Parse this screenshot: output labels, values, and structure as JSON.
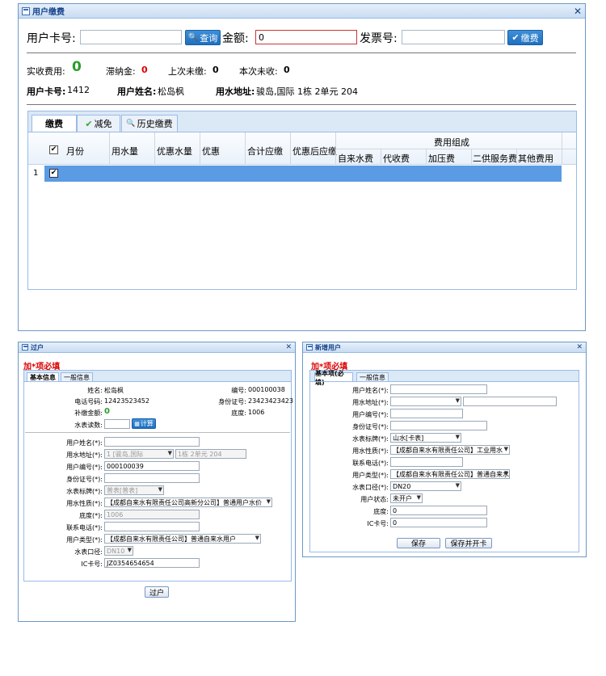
{
  "main": {
    "title": "用户缴费",
    "card_label": "用户卡号:",
    "card_value": "",
    "query_button": "查询",
    "amount_label": "金额:",
    "amount_value": "0",
    "invoice_label": "发票号:",
    "invoice_value": "",
    "pay_button": "缴费",
    "actual_label": "实收费用:",
    "actual_value": "0",
    "late_label": "滞纳金:",
    "late_value": "0",
    "last_unpaid_label": "上次未缴:",
    "last_unpaid_value": "0",
    "this_unpaid_label": "本次未收:",
    "this_unpaid_value": "0",
    "user_card_label": "用户卡号:",
    "user_card_value": "1412",
    "user_name_label": "用户姓名:",
    "user_name_value": "松岛枫",
    "address_label": "用水地址:",
    "address_value": "骏岛,国际 1栋 2单元 204",
    "tabs": [
      "缴费",
      "减免",
      "历史缴费"
    ],
    "grid": {
      "columns": [
        "月份",
        "用水量",
        "优惠水量",
        "优惠",
        "合计应缴",
        "优惠后应缴"
      ],
      "group_header": "费用组成",
      "sub_columns": [
        "自来水费",
        "代收费",
        "加压费",
        "二供服务费",
        "其他费用"
      ],
      "row_number": "1"
    }
  },
  "transfer": {
    "title": "过户",
    "required_note": "加*项必填",
    "tabs": [
      "基本信息",
      "一般信息"
    ],
    "info": {
      "name_label": "姓名:",
      "name_value": "松岛枫",
      "id_label": "编号:",
      "id_value": "000100038",
      "phone_label": "电话号码:",
      "phone_value": "12423523452",
      "idcard_label": "身份证号:",
      "idcard_value": "23423423423",
      "supplement_label": "补缴金额:",
      "supplement_value": "0",
      "base_label": "底度:",
      "base_value": "1006",
      "meter_label": "水表读数:",
      "calc_button": "计算"
    },
    "form": {
      "name_label": "用户姓名(*):",
      "name_value": "",
      "address_label": "用水地址(*):",
      "address_select": "1 [骏岛,国际",
      "address_detail": "1栋 2单元 204",
      "number_label": "用户编号(*):",
      "number_value": "000100039",
      "idcard_label": "身份证号(*):",
      "idcard_value": "",
      "meter_type_label": "水表标牌(*):",
      "meter_type_value": "普表[普表]",
      "nature_label": "用水性质(*):",
      "nature_value": "【成都自来水有限责任公司高新分公司】普通用户水价",
      "base_label": "底度(*):",
      "base_value": "1006",
      "phone_label": "联系电话(*):",
      "phone_value": "",
      "user_type_label": "用户类型(*):",
      "user_type_value": "【成都自来水有限责任公司】普通自来水用户",
      "caliber_label": "水表口径:",
      "caliber_value": "DN10",
      "ic_label": "IC卡号:",
      "ic_value": "JZ0354654654"
    },
    "submit_button": "过户"
  },
  "new_user": {
    "title": "新增用户",
    "required_note": "加*项必填",
    "tabs": [
      "基本项(必填)",
      "一般信息"
    ],
    "form": {
      "name_label": "用户姓名(*):",
      "address_label": "用水地址(*):",
      "number_label": "用户编号(*):",
      "idcard_label": "身份证号(*):",
      "meter_type_label": "水表标牌(*):",
      "meter_type_value": "山水[卡表]",
      "nature_label": "用水性质(*):",
      "nature_value": "【成都自来水有限责任公司】工业用水",
      "phone_label": "联系电话(*):",
      "user_type_label": "用户类型(*):",
      "user_type_value": "【成都自来水有限责任公司】普通自来水用",
      "caliber_label": "水表口径(*):",
      "caliber_value": "DN20",
      "status_label": "用户状态:",
      "status_value": "未开户",
      "base_label": "底度:",
      "base_value": "0",
      "ic_label": "IC卡号:",
      "ic_value": "0"
    },
    "save_button": "保存",
    "save_open_button": "保存并开卡"
  }
}
